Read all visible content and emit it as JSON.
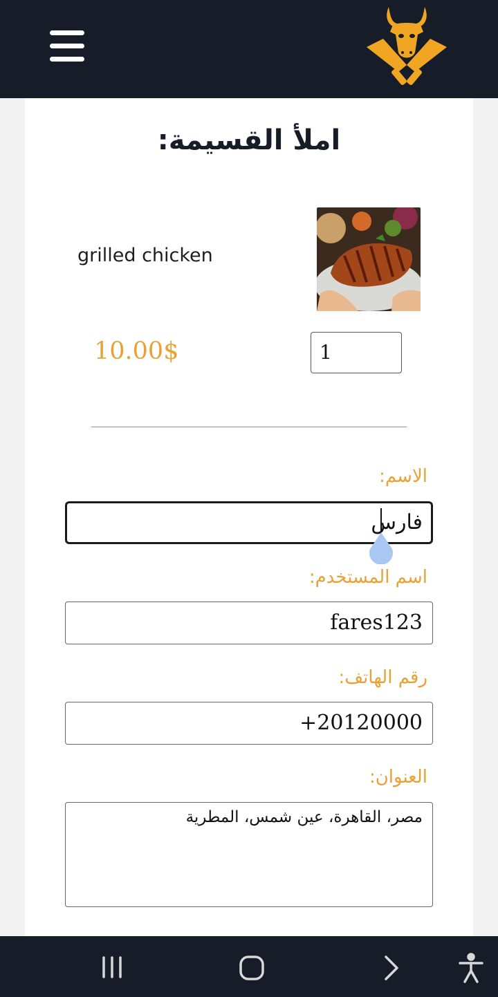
{
  "header": {
    "menu_icon": "hamburger-menu-icon",
    "logo_icon": "bull-cleavers-logo-icon",
    "brand_color": "#e9a135",
    "bar_color": "#161c28"
  },
  "form": {
    "title": "املأ القسيمة:",
    "item": {
      "name": "grilled chicken",
      "quantity": "1",
      "price": "10.00$"
    },
    "fields": {
      "name_label": "الاسم:",
      "name_value": "فارس",
      "username_label": "اسم المستخدم:",
      "username_value": "fares123",
      "phone_label": "رقم الهاتف:",
      "phone_value": "+20120000",
      "address_label": "العنوان:",
      "address_value": "مصر، القاهرة، عين شمس، المطرية"
    }
  },
  "system_nav": {
    "recents_icon": "recents-icon",
    "home_icon": "home-icon",
    "back_icon": "back-chevron-icon",
    "accessibility_icon": "accessibility-icon"
  }
}
